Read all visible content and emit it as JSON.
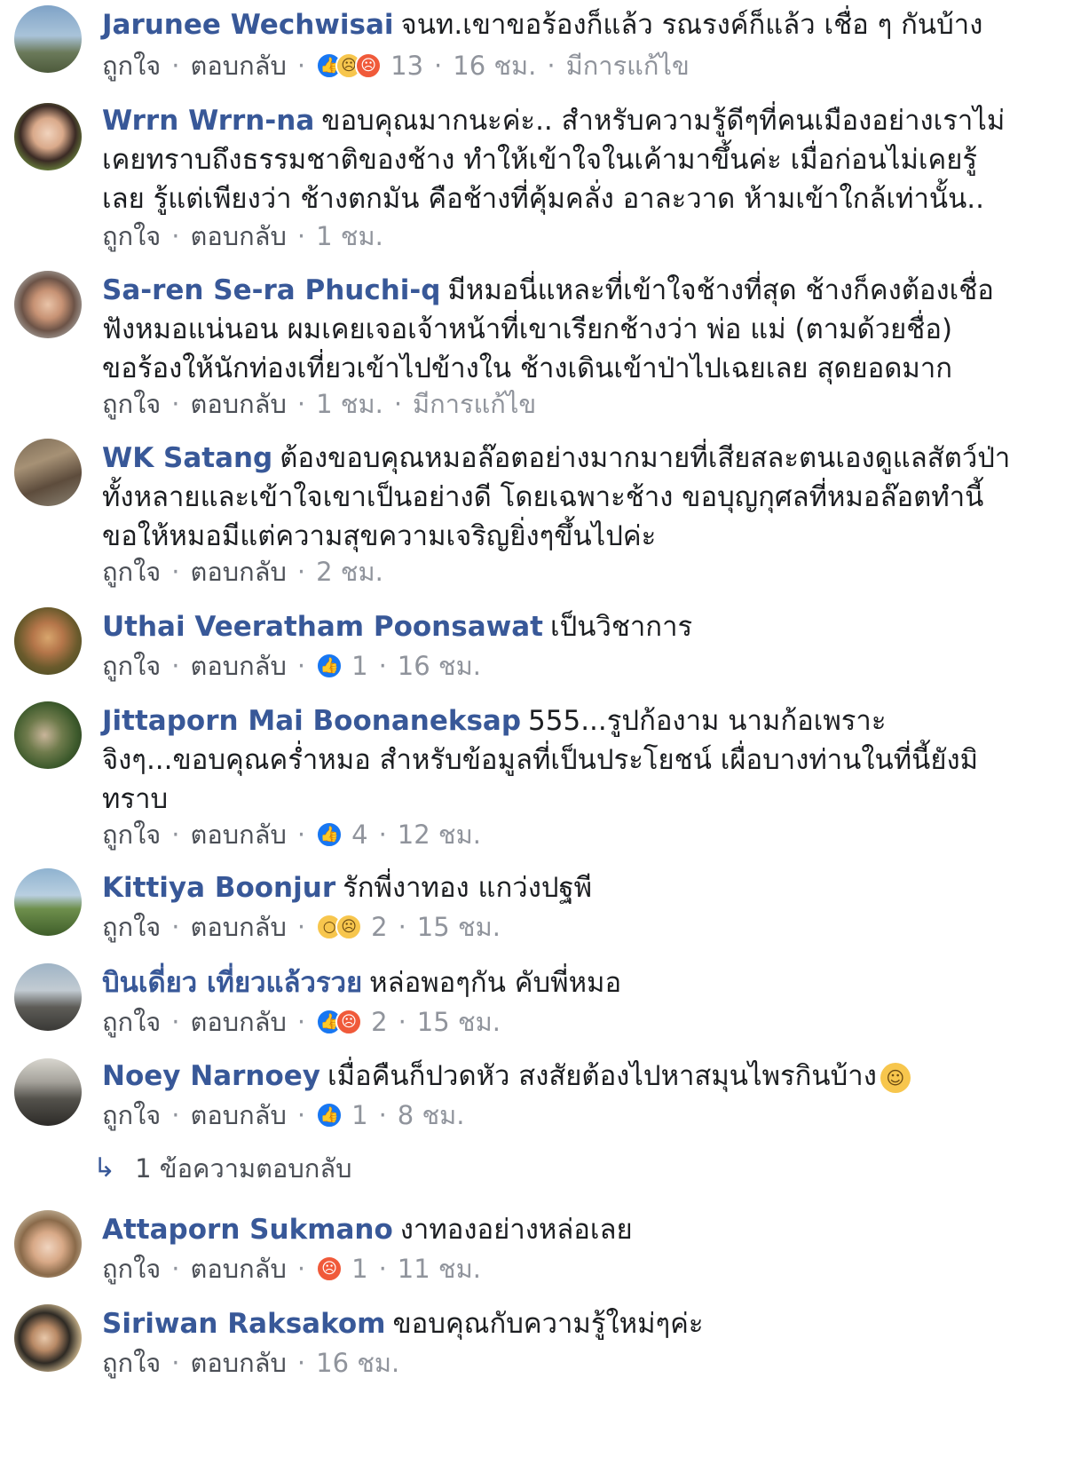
{
  "actions": {
    "like": "ถูกใจ",
    "reply": "ตอบกลับ",
    "dot": "·"
  },
  "comments": [
    {
      "name": "Jarunee Wechwisai",
      "text": "จนท.เขาขอร้องก็แล้ว รณรงค์ก็แล้ว เชื่อ ๆ กันบ้าง",
      "reactions": [
        "like",
        "sad",
        "angry"
      ],
      "count": "13",
      "time": "16 ชม.",
      "edited": "มีการแก้ไข"
    },
    {
      "name": "Wrrn Wrrn-na",
      "text": "ขอบคุณมากนะค่ะ.. สำหรับความรู้ดีๆที่คนเมืองอย่างเราไม่เคยทราบถึงธรรมชาติของช้าง ทำให้เข้าใจในเค้ามาขึ้นค่ะ เมื่อก่อนไม่เคยรู้เลย รู้แต่เพียงว่า ช้างตกมัน คือช้างที่คุ้มคลั่ง อาละวาด ห้ามเข้าใกล้เท่านั้น..",
      "reactions": [],
      "count": "",
      "time": "1 ชม.",
      "edited": ""
    },
    {
      "name": "Sa-ren Se-ra Phuchi-q",
      "text": "มีหมอนี่แหละที่เข้าใจช้างที่สุด ช้างก็คงต้องเชื่อฟังหมอแน่นอน ผมเคยเจอเจ้าหน้าที่เขาเรียกช้างว่า พ่อ แม่ (ตามด้วยชื่อ) ขอร้องให้นักท่องเที่ยวเข้าไปข้างใน ช้างเดินเข้าป่าไปเฉยเลย สุดยอดมาก",
      "reactions": [],
      "count": "",
      "time": "1 ชม.",
      "edited": "มีการแก้ไข"
    },
    {
      "name": "WK Satang",
      "text": "ต้องขอบคุณหมอล๊อตอย่างมากมายที่เสียสละตนเองดูแลสัตว์ป่าทั้งหลายและเข้าใจเขาเป็นอย่างดี โดยเฉพาะช้าง ขอบุญกุศลที่หมอล๊อตทำนี้ขอให้หมอมีแต่ความสุขความเจริญยิ่งๆขึ้นไปค่ะ",
      "reactions": [],
      "count": "",
      "time": "2 ชม.",
      "edited": ""
    },
    {
      "name": "Uthai Veeratham Poonsawat",
      "text": "เป็นวิชาการ",
      "reactions": [
        "like"
      ],
      "count": "1",
      "time": "16 ชม.",
      "edited": ""
    },
    {
      "name": "Jittaporn Mai Boonaneksap",
      "text": "555...รูปก้องาม นามก้อเพราะ จิงๆ...ขอบคุณคร่ำหมอ สำหรับข้อมูลที่เป็นประโยชน์ เผื่อบางท่านในที่นี้ยังมิทราบ",
      "reactions": [
        "like"
      ],
      "count": "4",
      "time": "12 ชม.",
      "edited": ""
    },
    {
      "name": "Kittiya Boonjur",
      "text": "รักพี่งาทอง แกว่งปฐพี",
      "reactions": [
        "wow",
        "sad"
      ],
      "count": "2",
      "time": "15 ชม.",
      "edited": ""
    },
    {
      "name": "บินเดี่ยว เที่ยวแล้วรวย",
      "text": "หล่อพอๆกัน คับพี่หมอ",
      "reactions": [
        "like",
        "angry"
      ],
      "count": "2",
      "time": "15 ชม.",
      "edited": ""
    },
    {
      "name": "Noey Narnoey",
      "text": "เมื่อคืนก็ปวดหัว สงสัยต้องไปหาสมุนไพรกินบ้าง",
      "reactions": [
        "like"
      ],
      "count": "1",
      "time": "8 ชม.",
      "edited": "",
      "replies_label": "1 ข้อความตอบกลับ"
    },
    {
      "name": "Attaporn Sukmano",
      "text": "งาทองอย่างหล่อเลย",
      "reactions": [
        "angry"
      ],
      "count": "1",
      "time": "11 ชม.",
      "edited": ""
    },
    {
      "name": "Siriwan Raksakom",
      "text": "ขอบคุณกับความรู้ใหม่ๆค่ะ",
      "reactions": [],
      "count": "",
      "time": "16 ชม.",
      "edited": ""
    }
  ],
  "icons": {
    "like": "like-icon",
    "sad": "sad-icon",
    "angry": "angry-icon",
    "wow": "wow-icon",
    "emoji": "sweat-smile-emoji",
    "reply_arrow": "reply-arrow-icon"
  }
}
